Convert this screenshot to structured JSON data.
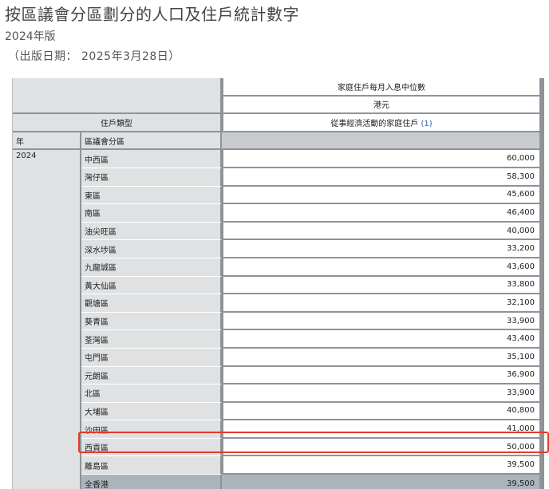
{
  "header": {
    "title": "按區議會分區劃分的人口及住戶統計數字",
    "edition": "2024年版",
    "pub_date": "（出版日期： 2025年3月28日）"
  },
  "table": {
    "measure_header": "家庭住戶每月入息中位數",
    "unit_header": "港元",
    "household_type_label": "住戶類型",
    "household_type_value": "從事經濟活動的家庭住戶",
    "household_type_note": "(1)",
    "year_col_label": "年",
    "district_col_label": "區議會分區",
    "year": "2024",
    "rows": [
      {
        "district": "中西區",
        "value": "60,000"
      },
      {
        "district": "灣仔區",
        "value": "58,300"
      },
      {
        "district": "東區",
        "value": "45,600"
      },
      {
        "district": "南區",
        "value": "46,400"
      },
      {
        "district": "油尖旺區",
        "value": "40,000"
      },
      {
        "district": "深水埗區",
        "value": "33,200"
      },
      {
        "district": "九龍城區",
        "value": "43,600"
      },
      {
        "district": "黃大仙區",
        "value": "33,800"
      },
      {
        "district": "觀塘區",
        "value": "32,100"
      },
      {
        "district": "葵青區",
        "value": "33,900"
      },
      {
        "district": "荃灣區",
        "value": "43,400"
      },
      {
        "district": "屯門區",
        "value": "35,100"
      },
      {
        "district": "元朗區",
        "value": "36,900"
      },
      {
        "district": "北區",
        "value": "33,900"
      },
      {
        "district": "大埔區",
        "value": "40,800"
      },
      {
        "district": "沙田區",
        "value": "41,000"
      },
      {
        "district": "西貢區",
        "value": "50,000"
      },
      {
        "district": "離島區",
        "value": "39,500"
      }
    ],
    "total": {
      "district": "全香港",
      "value": "39,500"
    }
  },
  "highlight_color": "#e23a2a"
}
